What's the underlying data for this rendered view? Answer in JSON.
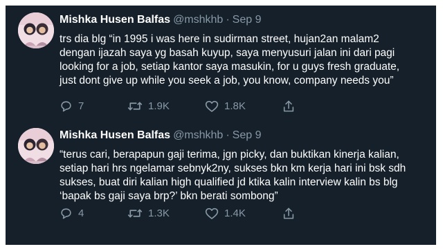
{
  "colors": {
    "background": "#15202b",
    "name_text": "#ffffff",
    "secondary_text": "#8899a6",
    "avatar_bg": "#f1dde4"
  },
  "tweets": [
    {
      "display_name": "Mishka Husen Balfas",
      "handle": "@mshkhb",
      "separator": "·",
      "date": "Sep 9",
      "lines": [
        "trs dia blg “in 1995 i was here in sudirman street, hujan2an malam2",
        "dengan ijazah saya yg basah kuyup, saya menyusuri jalan ini dari pagi",
        "looking for a job, setiap kantor saya masukin, for u guys fresh graduate,",
        "just dont give up while you seek a job, you know, company needs you”"
      ],
      "replies": "7",
      "retweets": "1.9K",
      "likes": "1.8K",
      "icons": {
        "reply": "reply-icon",
        "retweet": "retweet-icon",
        "like": "like-icon",
        "share": "share-icon"
      }
    },
    {
      "display_name": "Mishka Husen Balfas",
      "handle": "@mshkhb",
      "separator": "·",
      "date": "Sep 9",
      "lines": [
        "“terus cari, berapapun gaji terima, jgn picky, dan buktikan kinerja kalian,",
        "setiap hari hrs ngelamar sebnyk2ny, sukses bkn km kerja hari ini bsk sdh",
        "sukses, buat diri kalian high qualified jd ktika kalin interview kalin bs blg",
        "‘bapak bs gaji saya brp?’ bkn berati sombong”"
      ],
      "replies": "4",
      "retweets": "1.3K",
      "likes": "1.4K",
      "icons": {
        "reply": "reply-icon",
        "retweet": "retweet-icon",
        "like": "like-icon",
        "share": "share-icon"
      }
    }
  ]
}
